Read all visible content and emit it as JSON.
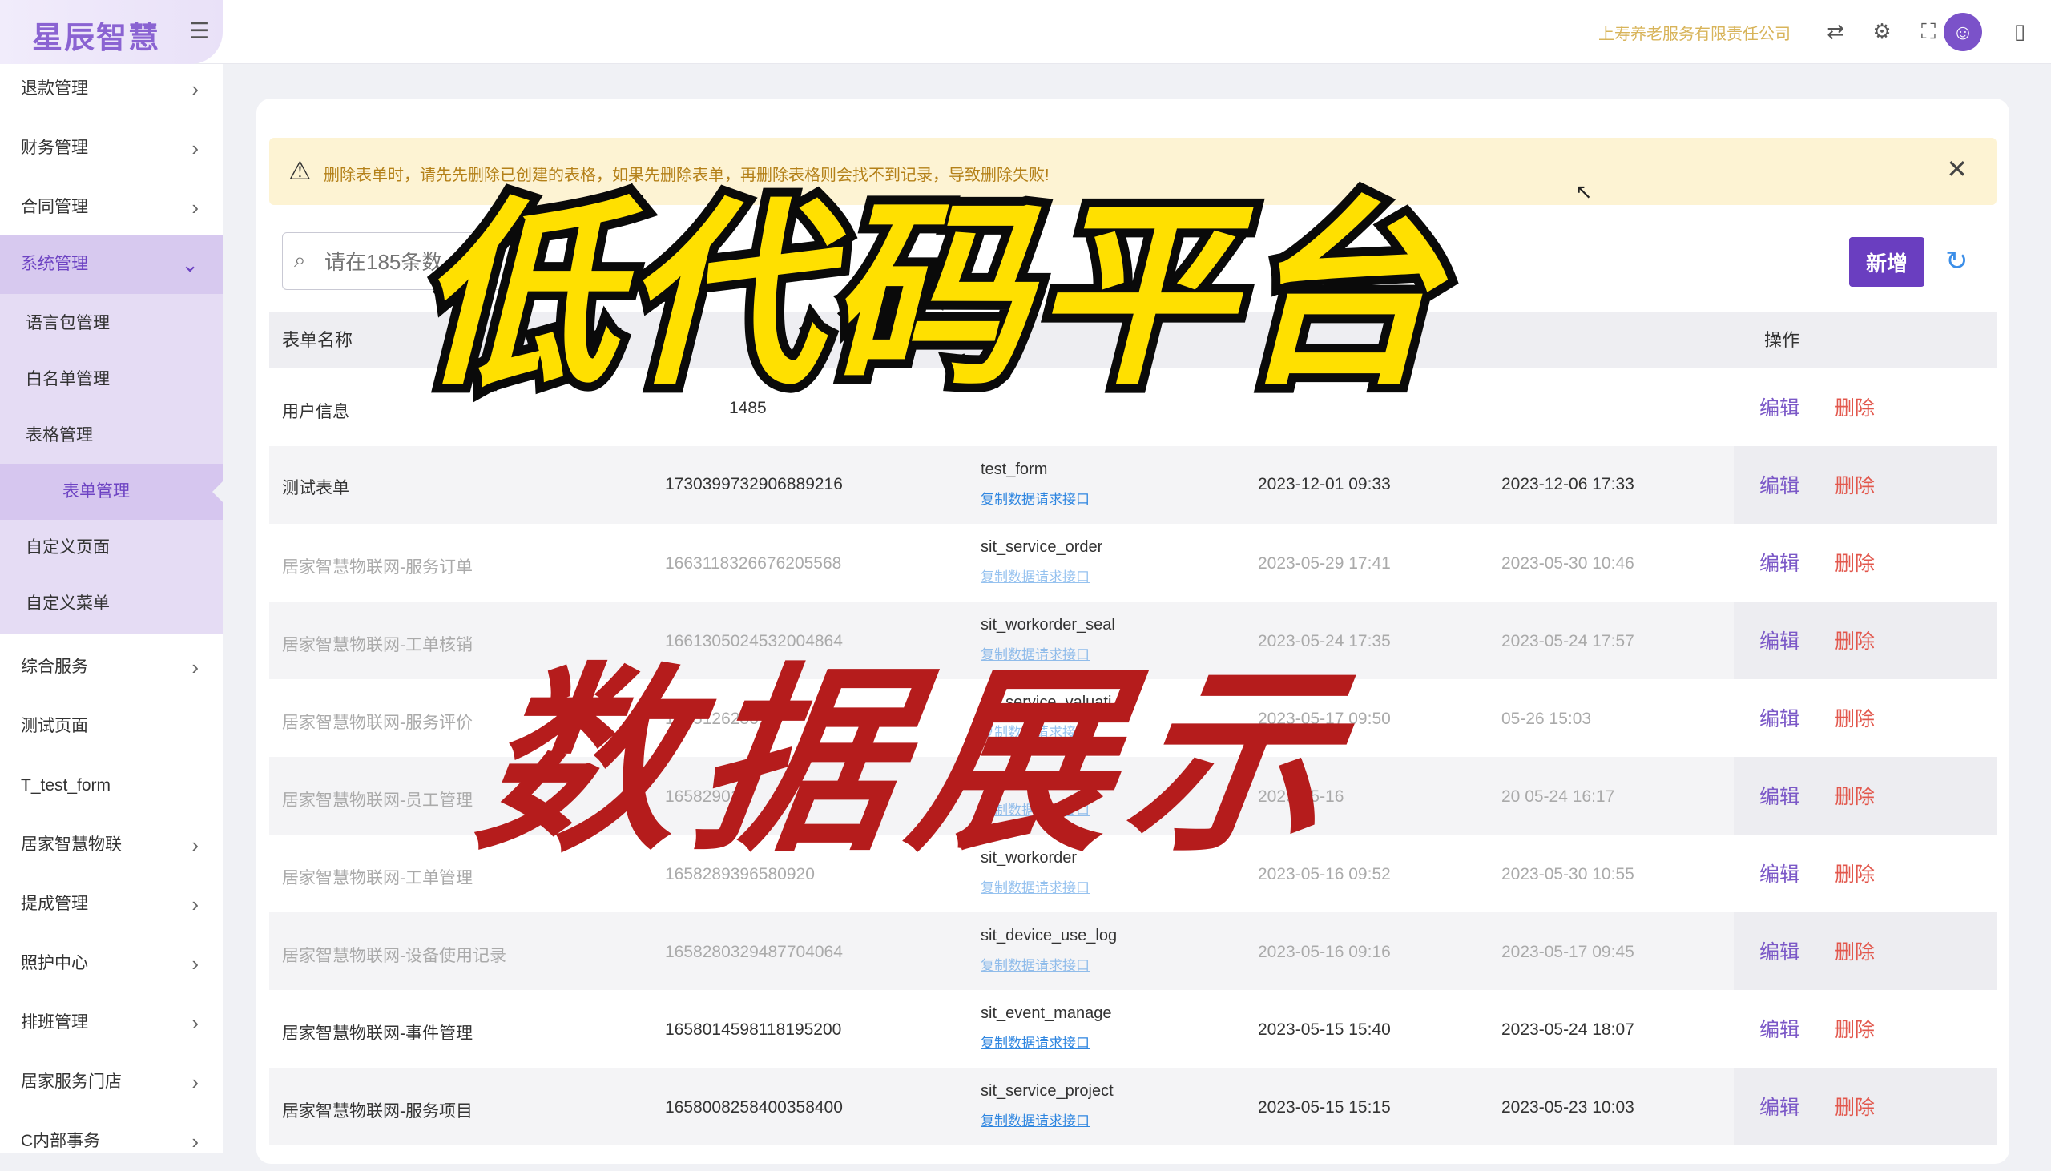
{
  "header": {
    "logo": "星辰智慧",
    "company": "上寿养老服务有限责任公司"
  },
  "sidebar": {
    "items_top": [
      "退款管理",
      "财务管理",
      "合同管理"
    ],
    "system": "系统管理",
    "sub_items": [
      "语言包管理",
      "白名单管理",
      "表格管理",
      "表单管理",
      "自定义页面",
      "自定义菜单"
    ],
    "items_bottom": [
      "综合服务",
      "测试页面",
      "T_test_form",
      "居家智慧物联",
      "提成管理",
      "照护中心",
      "排班管理",
      "居家服务门店",
      "C内部事务"
    ]
  },
  "alert": {
    "text": "删除表单时，请先先删除已创建的表格，如果先删除表单，再删除表格则会找不到记录，导致删除失败!"
  },
  "toolbar": {
    "search_placeholder": "请在185条数",
    "new_label": "新增"
  },
  "table": {
    "headers": [
      "表单名称",
      "U",
      "操作"
    ],
    "edit_label": "编辑",
    "delete_label": "删除",
    "link_label": "复制数据请求接口",
    "rows": [
      {
        "name": "用户信息",
        "id": "1485",
        "code": "",
        "created": "",
        "updated": ""
      },
      {
        "name": "测试表单",
        "id": "1730399732906889216",
        "code": "test_form",
        "created": "2023-12-01 09:33",
        "updated": "2023-12-06 17:33"
      },
      {
        "name": "居家智慧物联网-服务订单",
        "id": "1663118326676205568",
        "code": "sit_service_order",
        "created": "2023-05-29 17:41",
        "updated": "2023-05-30 10:46"
      },
      {
        "name": "居家智慧物联网-工单核销",
        "id": "1661305024532004864",
        "code": "sit_workorder_seal",
        "created": "2023-05-24 17:35",
        "updated": "2023-05-24 17:57"
      },
      {
        "name": "居家智慧物联网-服务评价",
        "id": "16651262861",
        "code": "sit_service_valuati",
        "created": "2023-05-17 09:50",
        "updated": "05-26 15:03"
      },
      {
        "name": "居家智慧物联网-员工管理",
        "id": "16582901",
        "code": "sit_staff_mana",
        "created": "2023-05-16",
        "updated": "20 05-24 16:17"
      },
      {
        "name": "居家智慧物联网-工单管理",
        "id": "1658289396580920",
        "code": "sit_workorder",
        "created": "2023-05-16 09:52",
        "updated": "2023-05-30 10:55"
      },
      {
        "name": "居家智慧物联网-设备使用记录",
        "id": "1658280329487704064",
        "code": "sit_device_use_log",
        "created": "2023-05-16 09:16",
        "updated": "2023-05-17 09:45"
      },
      {
        "name": "居家智慧物联网-事件管理",
        "id": "1658014598118195200",
        "code": "sit_event_manage",
        "created": "2023-05-15 15:40",
        "updated": "2023-05-24 18:07"
      },
      {
        "name": "居家智慧物联网-服务项目",
        "id": "1658008258400358400",
        "code": "sit_service_project",
        "created": "2023-05-15 15:15",
        "updated": "2023-05-23 10:03"
      }
    ]
  },
  "overlay": {
    "title": "低代码平台",
    "subtitle": "数据展示"
  },
  "colors": {
    "accent": "#6a3ec0",
    "link": "#2f86e0",
    "delete": "#e2574c",
    "alert_bg": "#fdf3d3"
  }
}
